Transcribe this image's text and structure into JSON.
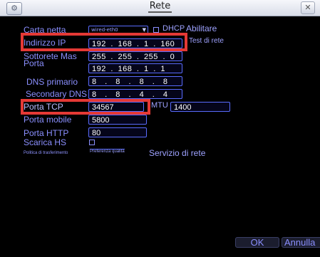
{
  "window": {
    "title": "Rete",
    "icon": "network-settings-icon",
    "close_icon": "close-icon"
  },
  "form": {
    "network_card": {
      "label": "Carta netta",
      "value": "wired-eth0",
      "dhcp_label": "DHCP",
      "dhcp_enabled_label": "Abilitare",
      "dhcp_checked": false
    },
    "ip_address": {
      "label": "Indirizzo IP",
      "value": "192 . 168 . 1 . 160",
      "test_label": "Test di rete"
    },
    "subnet_mask": {
      "label": "Sottorete Mas",
      "value": "255 . 255 . 255 . 0"
    },
    "gateway": {
      "label": "Porta",
      "value": "192 . 168 . 1 . 1"
    },
    "dns_primary": {
      "label": "DNS primario",
      "value": "8 . 8 . 8 . 8"
    },
    "dns_secondary": {
      "label": "Secondary DNS",
      "value": "8 . 8 . 4 . 4"
    },
    "tcp_port": {
      "label": "Porta TCP",
      "value": "34567",
      "mtu_label": "MTU",
      "mtu_value": "1400"
    },
    "mobile_port": {
      "label": "Porta mobile",
      "value": "5800"
    },
    "http_port": {
      "label": "Porta HTTP",
      "value": "80"
    },
    "hs_download": {
      "label": "Scarica HS",
      "checked": false
    },
    "transfer_policy": {
      "label": "Politica di trasferimento",
      "value": "Preferenza qualità"
    },
    "network_service": {
      "label": "Servizio di rete"
    }
  },
  "buttons": {
    "ok": "OK",
    "cancel": "Annulla"
  },
  "colors": {
    "background": "#000000",
    "label": "#8b8fff",
    "field_border": "#5a6cff",
    "highlight": "#e53935"
  }
}
